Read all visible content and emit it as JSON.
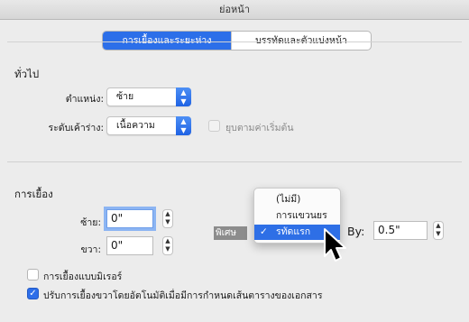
{
  "window": {
    "title": "ย่อหน้า"
  },
  "tabs": [
    {
      "label": "การเยื้องและระยะห่าง",
      "active": true
    },
    {
      "label": "บรรทัดและตัวแบ่งหน้า",
      "active": false
    }
  ],
  "general": {
    "heading": "ทั่วไป",
    "alignment_label": "ตำแหน่ง:",
    "alignment_value": "ซ้าย",
    "outline_label": "ระดับเค้าร่าง:",
    "outline_value": "เนื้อความ",
    "collapsed_label": "ยุบตามค่าเริ่มต้น"
  },
  "indentation": {
    "heading": "การเยื้อง",
    "left_label": "ซ้าย:",
    "left_value": "0\"",
    "right_label": "ขวา:",
    "right_value": "0\"",
    "special_label": "พิเศษ",
    "by_label": "By:",
    "by_value": "0.5\"",
    "mirror_label": "การเยื้องแบบมิเรอร์",
    "mirror_checked": false,
    "auto_adjust_label": "ปรับการเยื้องขวาโดยอัตโนมัติเมื่อมีการกำหนดเส้นตารางของเอกสาร",
    "auto_adjust_checked": true
  },
  "special_menu": {
    "items": [
      {
        "label": "(ไม่มี)",
        "selected": false
      },
      {
        "label": "การแขวนยร",
        "selected": false
      },
      {
        "label": "รทัดแรก",
        "selected": true
      }
    ]
  },
  "colors": {
    "accent": "#2c6fe9",
    "window_bg": "#ececec"
  }
}
